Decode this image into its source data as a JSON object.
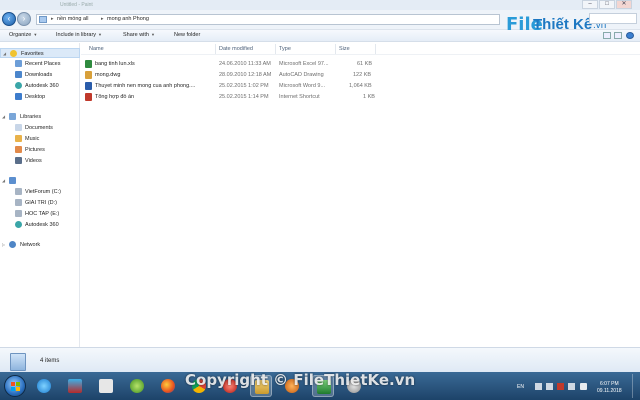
{
  "window": {
    "title": "Untitled - Paint",
    "controls": {
      "minimize": "–",
      "maximize": "□",
      "close": "✕"
    }
  },
  "address": {
    "crumbs": [
      "nền móng all",
      "mong anh Phong"
    ]
  },
  "logo": {
    "file": "File",
    "thiet_ke": "Thiết Kế",
    "vn": ".vn",
    "tagline": "Chia sẻ kiến thức"
  },
  "toolbar": {
    "organize": "Organize",
    "include_in_library": "Include in library",
    "share_with": "Share with",
    "new_folder": "New folder"
  },
  "nav": {
    "favorites": "Favorites",
    "favorites_items": [
      "Recent Places",
      "Downloads",
      "Autodesk 360",
      "Desktop"
    ],
    "libraries": "Libraries",
    "libraries_items": [
      "Documents",
      "Music",
      "Pictures",
      "Videos"
    ],
    "computer_items": [
      "VietForum (C:)",
      "GIAI TRI (D:)",
      "HOC TAP (E:)",
      "Autodesk 360"
    ],
    "network": "Network"
  },
  "columns": {
    "name": "Name",
    "date": "Date modified",
    "type": "Type",
    "size": "Size"
  },
  "files": [
    {
      "name": "bang tinh lun.xls",
      "date": "24.06.2010 11:33 AM",
      "type": "Microsoft Excel 97...",
      "size": "61 KB",
      "icon": "excel-icon"
    },
    {
      "name": "mong.dwg",
      "date": "28.09.2010 12:18 AM",
      "type": "AutoCAD Drawing",
      "size": "122 KB",
      "icon": "autocad-icon"
    },
    {
      "name": "Thuyet minh nen mong cua anh phong....",
      "date": "25.02.2015 1:02 PM",
      "type": "Microsoft Word 9...",
      "size": "1,064 KB",
      "icon": "word-icon"
    },
    {
      "name": "Tổng hợp đồ án",
      "date": "25.02.2015 1:14 PM",
      "type": "Internet Shortcut",
      "size": "1 KB",
      "icon": "shortcut-icon"
    }
  ],
  "status": {
    "count": "4 items"
  },
  "taskbar": {
    "language": "EN",
    "time": "6:07 PM",
    "date": "09.11.2018"
  },
  "watermark": "Copyright © FileThietKe.vn",
  "colors": {
    "accent": "#1e78c2",
    "logo_light": "#2a9bd8",
    "taskbar": "#1d4369",
    "selection": "#dbe9f8"
  }
}
